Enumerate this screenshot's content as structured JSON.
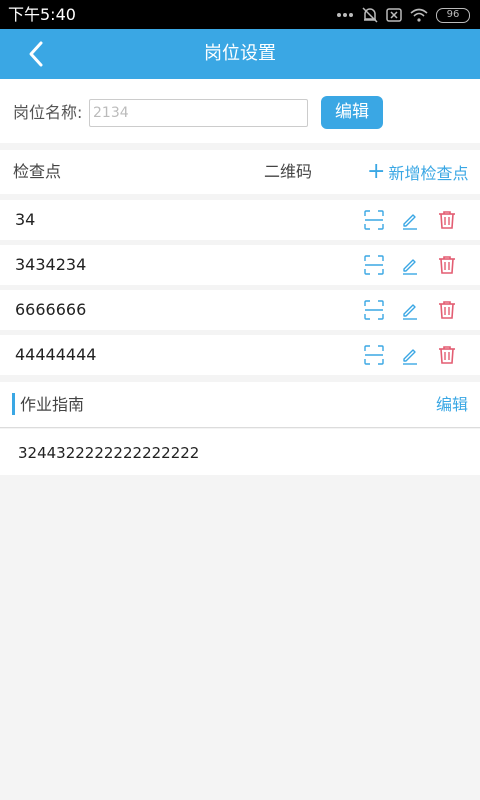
{
  "status_bar": {
    "time": "下午5:40",
    "battery": "96"
  },
  "nav": {
    "title": "岗位设置",
    "back_icon": "chevron-left-icon"
  },
  "job_name": {
    "label": "岗位名称:",
    "placeholder": "2134",
    "edit_button": "编辑"
  },
  "checkpoints": {
    "header": {
      "label": "检查点",
      "qr_label": "二维码",
      "add_button": "新增检查点"
    },
    "items": [
      {
        "name": "34"
      },
      {
        "name": "3434234"
      },
      {
        "name": "6666666"
      },
      {
        "name": "44444444"
      }
    ],
    "icons": {
      "qr": "qr-scan-icon",
      "edit": "pencil-icon",
      "delete": "trash-icon"
    },
    "colors": {
      "qr": "#3aa7e4",
      "edit": "#3aa7e4",
      "delete": "#e35d72"
    }
  },
  "guide": {
    "title": "作业指南",
    "edit_link": "编辑",
    "content": "3244322222222222222"
  },
  "colors": {
    "accent": "#3aa7e4",
    "background": "#f4f4f4"
  }
}
